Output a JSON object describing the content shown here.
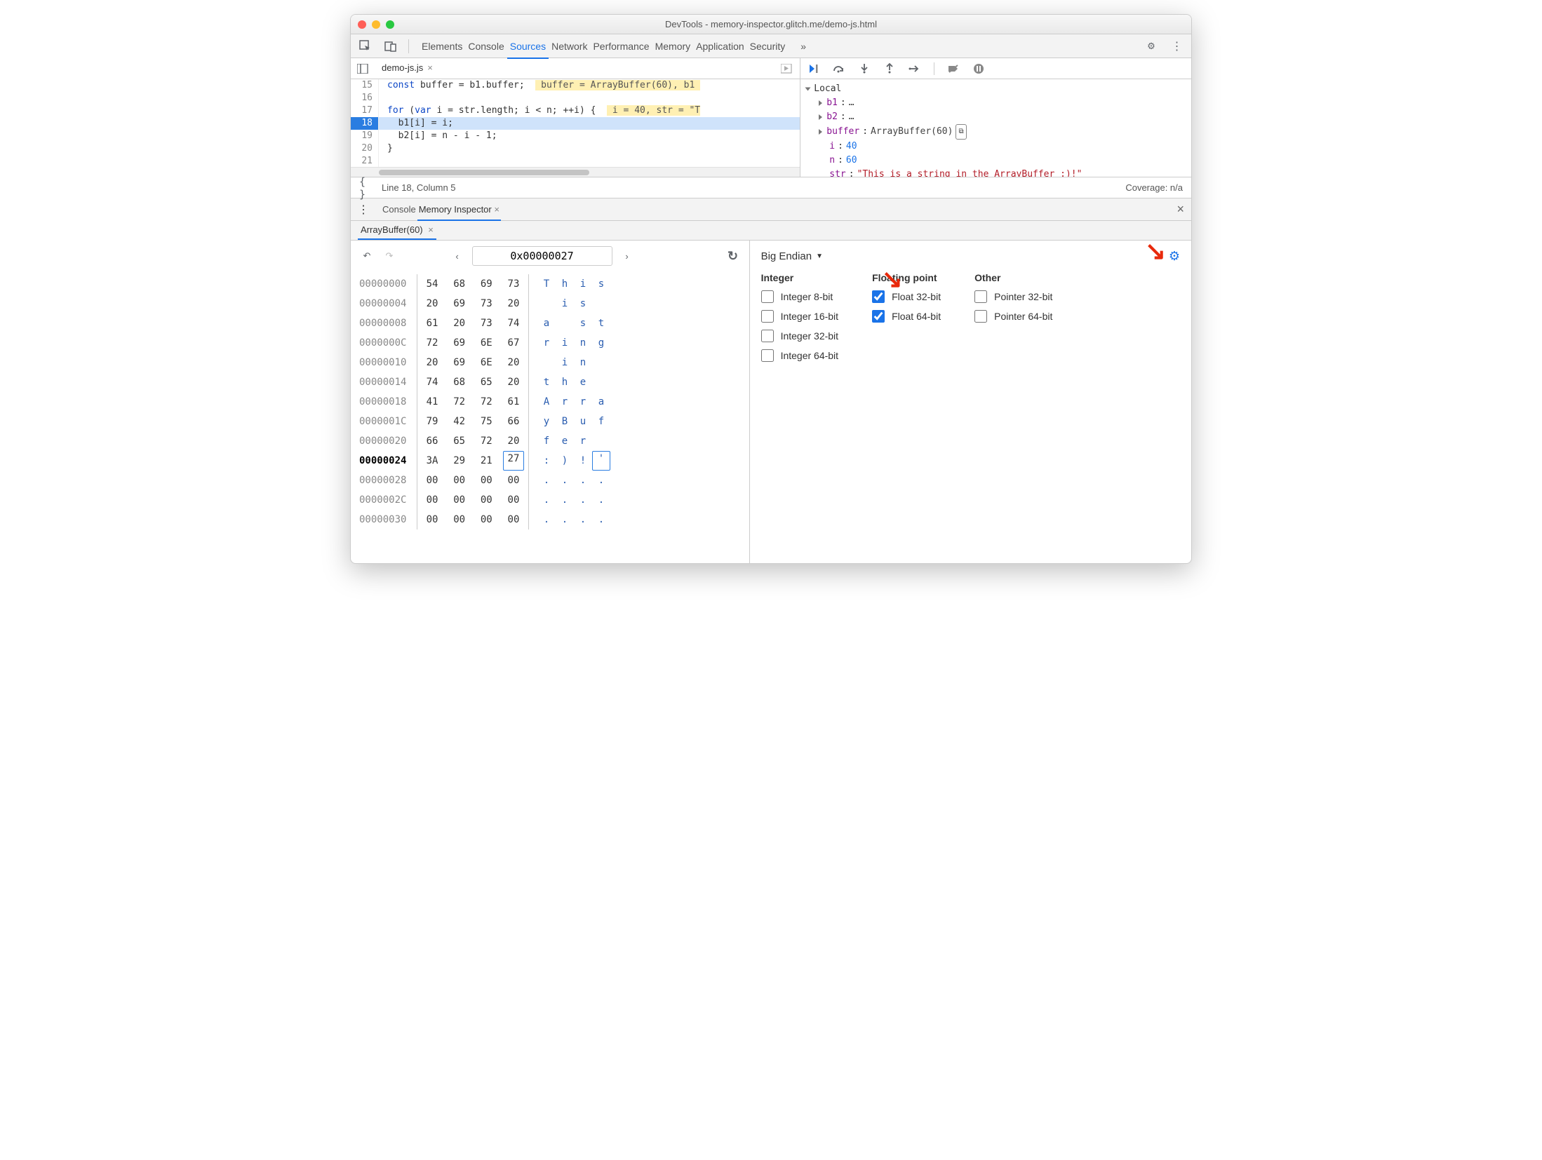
{
  "window": {
    "title": "DevTools - memory-inspector.glitch.me/demo-js.html"
  },
  "toolbar": {
    "tabs": [
      "Elements",
      "Console",
      "Sources",
      "Network",
      "Performance",
      "Memory",
      "Application",
      "Security"
    ],
    "active": "Sources",
    "overflow": "»"
  },
  "file_tab": {
    "name": "demo-js.js",
    "close": "×"
  },
  "code": {
    "lines": [
      {
        "n": 15,
        "text": "const buffer = b1.buffer;",
        "hint": "buffer = ArrayBuffer(60), b1 "
      },
      {
        "n": 16,
        "text": ""
      },
      {
        "n": 17,
        "text": "for (var i = str.length; i < n; ++i) {",
        "hint": "i = 40, str = \"T"
      },
      {
        "n": 18,
        "text": "  b1[i] = i;",
        "current": true
      },
      {
        "n": 19,
        "text": "  b2[i] = n - i - 1;"
      },
      {
        "n": 20,
        "text": "}"
      },
      {
        "n": 21,
        "text": ""
      }
    ]
  },
  "status": {
    "left": "Line 18, Column 5",
    "right": "Coverage: n/a"
  },
  "scope": {
    "header": "Local",
    "items": [
      {
        "name": "b1",
        "value": "…",
        "expandable": true
      },
      {
        "name": "b2",
        "value": "…",
        "expandable": true
      },
      {
        "name": "buffer",
        "value": "ArrayBuffer(60)",
        "expandable": true,
        "icon": true
      },
      {
        "name": "i",
        "value": "40",
        "num": true
      },
      {
        "name": "n",
        "value": "60",
        "num": true
      },
      {
        "name": "str",
        "value": "\"This is a string in the ArrayBuffer :)!\"",
        "str": true
      }
    ]
  },
  "drawer": {
    "tabs": [
      "Console",
      "Memory Inspector"
    ],
    "active": "Memory Inspector",
    "close": "×"
  },
  "mi_tab": {
    "name": "ArrayBuffer(60)",
    "close": "×"
  },
  "mi_nav": {
    "address": "0x00000027"
  },
  "hex_rows": [
    {
      "addr": "00000000",
      "b": [
        "54",
        "68",
        "69",
        "73"
      ],
      "a": [
        "T",
        "h",
        "i",
        "s"
      ]
    },
    {
      "addr": "00000004",
      "b": [
        "20",
        "69",
        "73",
        "20"
      ],
      "a": [
        " ",
        "i",
        "s",
        " "
      ]
    },
    {
      "addr": "00000008",
      "b": [
        "61",
        "20",
        "73",
        "74"
      ],
      "a": [
        "a",
        " ",
        "s",
        "t"
      ]
    },
    {
      "addr": "0000000C",
      "b": [
        "72",
        "69",
        "6E",
        "67"
      ],
      "a": [
        "r",
        "i",
        "n",
        "g"
      ]
    },
    {
      "addr": "00000010",
      "b": [
        "20",
        "69",
        "6E",
        "20"
      ],
      "a": [
        " ",
        "i",
        "n",
        " "
      ]
    },
    {
      "addr": "00000014",
      "b": [
        "74",
        "68",
        "65",
        "20"
      ],
      "a": [
        "t",
        "h",
        "e",
        " "
      ]
    },
    {
      "addr": "00000018",
      "b": [
        "41",
        "72",
        "72",
        "61"
      ],
      "a": [
        "A",
        "r",
        "r",
        "a"
      ]
    },
    {
      "addr": "0000001C",
      "b": [
        "79",
        "42",
        "75",
        "66"
      ],
      "a": [
        "y",
        "B",
        "u",
        "f"
      ]
    },
    {
      "addr": "00000020",
      "b": [
        "66",
        "65",
        "72",
        "20"
      ],
      "a": [
        "f",
        "e",
        "r",
        " "
      ]
    },
    {
      "addr": "00000024",
      "b": [
        "3A",
        "29",
        "21",
        "27"
      ],
      "a": [
        ":",
        ")",
        "!",
        "'"
      ],
      "bold": true,
      "hl": 3
    },
    {
      "addr": "00000028",
      "b": [
        "00",
        "00",
        "00",
        "00"
      ],
      "a": [
        ".",
        ".",
        ".",
        "."
      ]
    },
    {
      "addr": "0000002C",
      "b": [
        "00",
        "00",
        "00",
        "00"
      ],
      "a": [
        ".",
        ".",
        ".",
        "."
      ]
    },
    {
      "addr": "00000030",
      "b": [
        "00",
        "00",
        "00",
        "00"
      ],
      "a": [
        ".",
        ".",
        ".",
        "."
      ]
    }
  ],
  "settings": {
    "endian": "Big Endian",
    "groups": [
      {
        "title": "Integer",
        "items": [
          {
            "label": "Integer 8-bit",
            "checked": false
          },
          {
            "label": "Integer 16-bit",
            "checked": false
          },
          {
            "label": "Integer 32-bit",
            "checked": false
          },
          {
            "label": "Integer 64-bit",
            "checked": false
          }
        ]
      },
      {
        "title": "Floating point",
        "items": [
          {
            "label": "Float 32-bit",
            "checked": true
          },
          {
            "label": "Float 64-bit",
            "checked": true
          }
        ]
      },
      {
        "title": "Other",
        "items": [
          {
            "label": "Pointer 32-bit",
            "checked": false
          },
          {
            "label": "Pointer 64-bit",
            "checked": false
          }
        ]
      }
    ]
  }
}
